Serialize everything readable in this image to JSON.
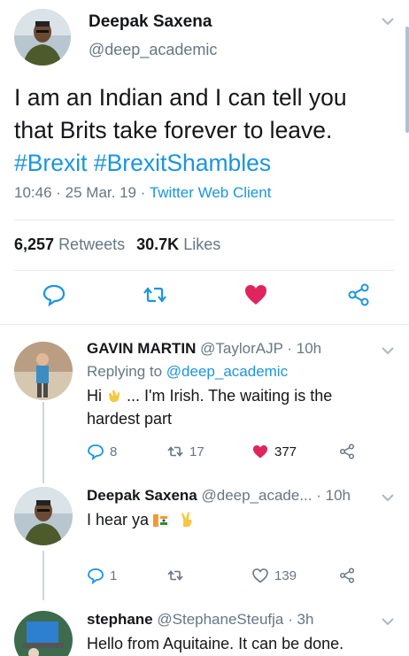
{
  "main_tweet": {
    "author_name": "Deepak Saxena",
    "author_handle": "@deep_academic",
    "text_line1": "I am an Indian and I can tell you",
    "text_line2": "that Brits take forever to leave.",
    "hashtag1": "#Brexit",
    "hashtag2": "#BrexitShambles",
    "time": "10:46",
    "date": "25 Mar. 19",
    "client": "Twitter Web Client",
    "retweets_count": "6,257",
    "retweets_label": "Retweets",
    "likes_count": "30.7K",
    "likes_label": "Likes",
    "liked": true,
    "icons": [
      "reply-icon",
      "retweet-icon",
      "like-icon",
      "share-icon"
    ]
  },
  "replies": [
    {
      "author_name": "GAVIN MARTIN",
      "author_handle": "@TaylorAJP",
      "age": "10h",
      "replying_label": "Replying to",
      "replying_to": "@deep_academic",
      "text_prefix": "Hi",
      "text_line1": "... I'm Irish. The waiting is the",
      "text_line2": "hardest part",
      "emoji": "clapping-hands",
      "reply_count": "8",
      "retweet_count": "17",
      "like_count": "377",
      "liked": true
    },
    {
      "author_name": "Deepak Saxena",
      "author_handle": "@deep_acade...",
      "age": "10h",
      "text": "I hear ya",
      "emoji": "india-flag victory-hand",
      "reply_count": "1",
      "retweet_count": "",
      "like_count": "139",
      "liked": false
    },
    {
      "author_name": "stephane",
      "author_handle": "@StephaneSteufja",
      "age": "3h",
      "text": "Hello from Aquitaine. It can be done."
    }
  ],
  "colors": {
    "accent": "#1b95e0",
    "like": "#e0245e",
    "muted": "#657786",
    "text": "#14171a"
  }
}
